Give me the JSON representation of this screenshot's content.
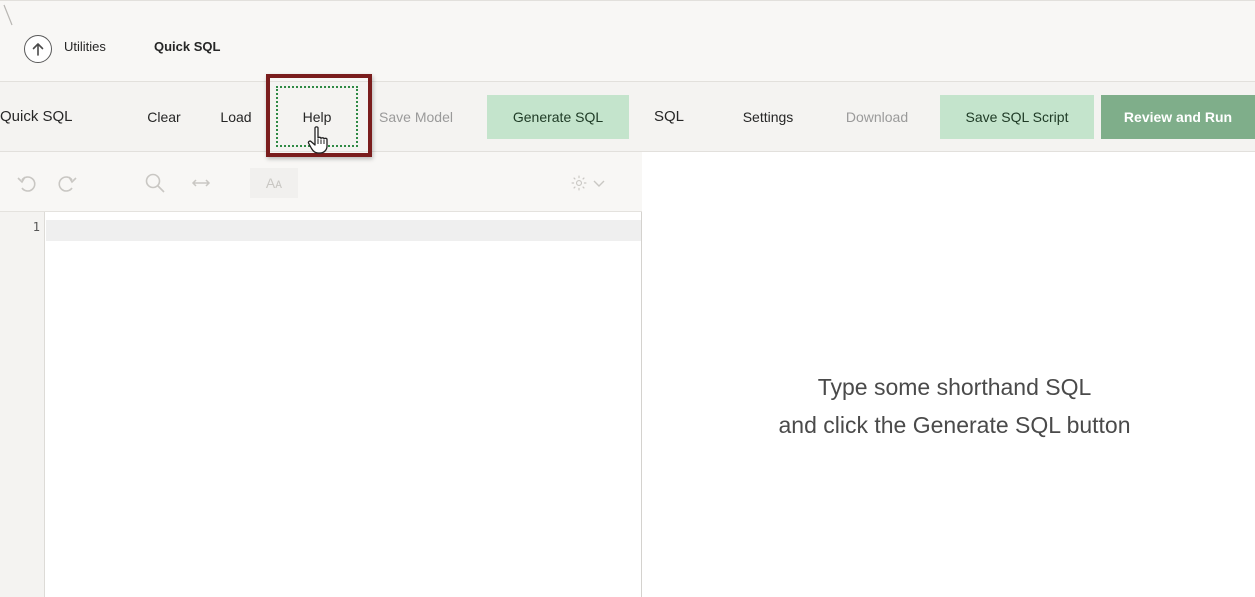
{
  "breadcrumb": {
    "parent": "Utilities",
    "current": "Quick SQL"
  },
  "toolbar": {
    "left_title": "Quick SQL",
    "clear": "Clear",
    "load": "Load",
    "help": "Help",
    "save_model": "Save Model",
    "generate_sql": "Generate SQL",
    "right_title": "SQL",
    "settings": "Settings",
    "download": "Download",
    "save_sql_script": "Save SQL Script",
    "review_and_run": "Review and Run"
  },
  "editor": {
    "line_numbers": [
      "1"
    ],
    "icons": [
      "undo-icon",
      "redo-icon",
      "search-icon",
      "replace-icon",
      "text-case-icon",
      "settings-icon"
    ]
  },
  "output": {
    "placeholder_line1": "Type some shorthand SQL",
    "placeholder_line2": "and click the Generate SQL button"
  },
  "colors": {
    "primary_green": "#c4e4cc",
    "review_green": "#7fae8a",
    "highlight": "#7a1d1d",
    "focus_dotted": "#2f8a45"
  }
}
